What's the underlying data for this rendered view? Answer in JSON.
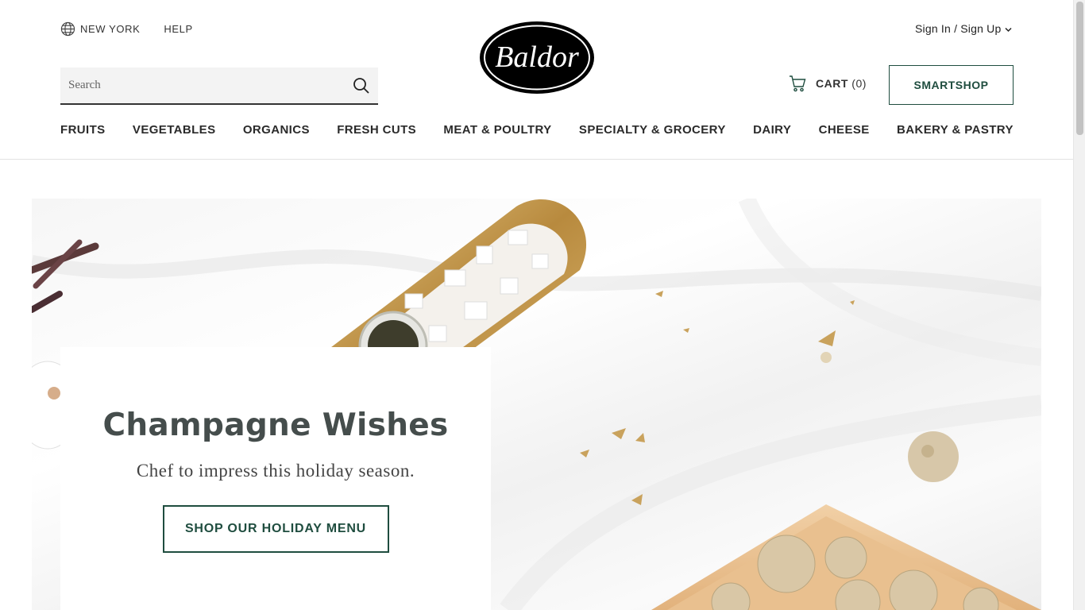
{
  "header": {
    "location": "NEW YORK",
    "help": "HELP",
    "search": {
      "placeholder": "Search",
      "value": ""
    },
    "logo_text": "Baldor",
    "account": "Sign In / Sign Up",
    "cart": {
      "label": "CART",
      "count": "(0)"
    },
    "smartshop": "SMARTSHOP"
  },
  "nav": {
    "items": [
      {
        "label": "FRUITS"
      },
      {
        "label": "VEGETABLES"
      },
      {
        "label": "ORGANICS"
      },
      {
        "label": "FRESH CUTS"
      },
      {
        "label": "MEAT & POULTRY"
      },
      {
        "label": "SPECIALTY & GROCERY"
      },
      {
        "label": "DAIRY"
      },
      {
        "label": "CHEESE"
      },
      {
        "label": "BAKERY & PASTRY"
      }
    ]
  },
  "hero": {
    "title": "Champagne Wishes",
    "subtitle": "Chef to impress this holiday season.",
    "cta": "SHOP OUR HOLIDAY MENU"
  },
  "colors": {
    "brand_green": "#1f4d3f",
    "title_gray": "#454d4c",
    "gold": "#c9a25c"
  },
  "icons": [
    "globe-icon",
    "search-icon",
    "chevron-down-icon",
    "cart-icon"
  ]
}
